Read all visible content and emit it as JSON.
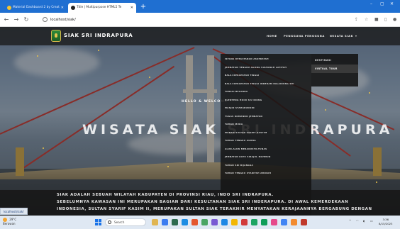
{
  "browser": {
    "tabs": [
      {
        "label": "Material Dashboard 2 by Creat"
      },
      {
        "label": "Title | Multipurpose HTML5 Te"
      }
    ],
    "new_tab": "+",
    "address": "localhost/siak/",
    "window_controls": [
      "–",
      "▢",
      "✕"
    ]
  },
  "site": {
    "brand": "SIAK SRI INDRAPURA",
    "nav": [
      "HOME",
      "PENGGUNA PENGGUNA",
      "WISATA SIAK"
    ],
    "nav_active_caret": "▾",
    "dropdown": [
      "ISTANA KESULTANAN ASSERAYAH",
      "JEMBATAN TENGKU AGUNG SULTANAH LATIFAH",
      "BALAI KERAPATAN TINGGI",
      "BALAI KERAPATAN TINGGI INDERAM BALAIRUNG SRI",
      "TANGSI BELANDA",
      "KLENTENG HOCK SIU KIONG",
      "MASJID SYAHABUDDIN",
      "TUGAS KOMANDO JEMBATAN",
      "TAMAN MUDA",
      "MAKAM SULTAN SYARIF KASYIM",
      "TAMAN TENGKU AGUNG",
      "ALUN-ALUN MERAKUSTO-TUNAS",
      "JEMBATAN RATU SIRAJUL MAHMUD",
      "TAMAN SRI BIJANGSA",
      "TAMAN TENGKU SYARIFAH AMINAH"
    ],
    "submenu": [
      {
        "label": "DESTINASI",
        "active": false
      },
      {
        "label": "VIRTUAL TOUR",
        "active": true
      }
    ],
    "welcome": "HELLO & WELCOME",
    "hero_title": "WISATA SIAK SRI INDRAPURA",
    "description": [
      "SIAK ADALAH SEBUAH WILAYAH KABUPATEN DI PROVINSI RIAU, INDO                                    SRI INDRAPURA.",
      "SEBELUMNYA KAWASAN INI MERUPAKAN BAGIAN DARI KESULTANAN SIAK SRI INDERAPURA. DI AWAL KEMERDEKAAN",
      "INDONESIA, SULTAN SYARIF KASIM II, MERUPAKAN SULTAN SIAK TERAKHIR MENYATAKAN KERAJAANNYA BERGABUNG DENGAN"
    ],
    "status_url": "localhost/siak/"
  },
  "taskbar": {
    "weather_temp": "29°C",
    "weather_text": "Berawan",
    "search_label": "Search",
    "tray_caret": "^",
    "clock_time": "3:36",
    "clock_date": "8/15/2023"
  },
  "colors": {
    "browser_blue": "#1f6fd1",
    "accent_gold": "#e9c24a",
    "logo_green": "#2e8b3a"
  }
}
